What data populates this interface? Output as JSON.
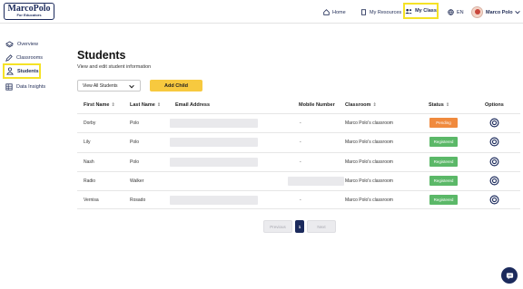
{
  "logo": {
    "main": "MarcoPolo",
    "sub": "For Educators"
  },
  "nav": {
    "home": "Home",
    "resources": "My Resources",
    "my_class": "My Class",
    "lang": "EN",
    "user": "Marco Polo"
  },
  "sidebar": {
    "items": [
      {
        "label": "Overview",
        "icon": "layers-icon"
      },
      {
        "label": "Classrooms",
        "icon": "pencil-icon"
      },
      {
        "label": "Students",
        "icon": "student-icon"
      },
      {
        "label": "Data Insights",
        "icon": "table-icon"
      }
    ]
  },
  "main": {
    "title": "Students",
    "subtitle": "View and edit student information",
    "filter_value": "View All Students",
    "add_button": "Add Child"
  },
  "table": {
    "headers": [
      "First Name",
      "Last Name",
      "Email Address",
      "Mobile Number",
      "Classroom",
      "Status",
      "Options"
    ],
    "rows": [
      {
        "first": "Dorby",
        "last": "Polo",
        "mobile": "-",
        "classroom": "Marco Polo's classroom",
        "status": "Pending",
        "status_color": "#f08a3e"
      },
      {
        "first": "Lily",
        "last": "Polo",
        "mobile": "-",
        "classroom": "Marco Polo's classroom",
        "status": "Registered",
        "status_color": "#5bb868"
      },
      {
        "first": "Nash",
        "last": "Polo",
        "mobile": "-",
        "classroom": "Marco Polo's classroom",
        "status": "Registered",
        "status_color": "#5bb868"
      },
      {
        "first": "Radio",
        "last": "Walker",
        "mobile": "",
        "classroom": "Marco Polo's classroom",
        "status": "Registered",
        "status_color": "#5bb868"
      },
      {
        "first": "Vernisa",
        "last": "Rosado",
        "mobile": "-",
        "classroom": "Marco Polo's classroom",
        "status": "Registered",
        "status_color": "#5bb868"
      }
    ]
  },
  "pagination": {
    "prev": "Previous",
    "current": "1",
    "next": "Next"
  },
  "colors": {
    "accent": "#f7c93f",
    "highlight": "#f5e226",
    "navy": "#1b2a5c"
  }
}
